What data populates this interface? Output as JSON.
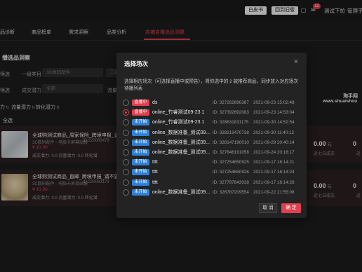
{
  "topbar": {
    "whitepaper": "白皮书",
    "back_old": "回到旧版",
    "notif_count": "12",
    "test_shop": "测试下拉",
    "admin": "管理子号"
  },
  "nav": {
    "items": [
      "品诊断",
      "商品榜单",
      "需求洞察",
      "品类分析",
      "店铺自播选品测算"
    ]
  },
  "section": {
    "title": "播选品洞察",
    "filter1_label": "筛选",
    "category_label": "一级类目",
    "category_value": "3C数码配件",
    "level2_placeholder": "二级",
    "filter2_label": "筛选",
    "deal_potential_label": "成交潜力",
    "deal_potential_value": "全部",
    "traffic_label": "流量",
    "sort": [
      "力",
      "流量潜力",
      "转化潜力"
    ],
    "selected_label": "全选"
  },
  "cards": [
    {
      "title": "全球购测试商品_周家保险_跨境申报_请不要",
      "category": "3C数码配件 - 电脑卡屏幕贴膜",
      "id": "ID:220083479",
      "price": "¥ 10.00",
      "stats": "成交潜力: 0.0   流量潜力: 0.0   转化潜",
      "value": "0.00",
      "unit": "元",
      "note": "近七日成交",
      "note2": "近"
    },
    {
      "title": "全球购测试商品_直邮_跨境申报_请不要拍",
      "category": "3C数码配件 - 电脑卡屏幕贴膜",
      "id": "ID:220083179",
      "price": "¥ 10.00",
      "stats": "成交潜力: 0.0   流量潜力: 0.0   转化潜",
      "value": "0.00",
      "unit": "元",
      "note": "近七日成交",
      "note2": "近"
    }
  ],
  "watermark": {
    "line1": "淘手网",
    "line2": "www.shuaishou"
  },
  "modal": {
    "title": "选择场次",
    "close": "×",
    "description": "选择相应场次（可选择直播中或预告），将你选中的 2 款推荐商品，同步放入对应场次待播列表",
    "tags": {
      "live": "直播中",
      "soon": "未开始"
    },
    "sessions": [
      {
        "status": "live",
        "name": "ds",
        "id": "ID:  327262696387",
        "time": "2021-09-23  15:02:48",
        "checked": false
      },
      {
        "status": "live",
        "name": "online_竹睿测试09-23 1",
        "id": "ID:  327392692083",
        "time": "2021-09-23  14:53:04",
        "checked": true
      },
      {
        "status": "soon",
        "name": "online_竹睿测试09-23 1",
        "id": "ID:  328631831175",
        "time": "2021-09-30  14:52:54",
        "checked": false
      },
      {
        "status": "soon",
        "name": "online_数据准备_测试09...",
        "id": "ID:  328213470738",
        "time": "2021-09-30  11:40:12",
        "checked": false
      },
      {
        "status": "soon",
        "name": "online_数据准备_测试09...",
        "id": "ID:  328147190010",
        "time": "2021-09-29  20:40:14",
        "checked": false
      },
      {
        "status": "soon",
        "name": "online_数据准备_测试09...",
        "id": "ID:  327846191058",
        "time": "2021-09-24  20:18:17",
        "checked": false
      },
      {
        "status": "soon",
        "name": "tttt",
        "id": "ID:  327254650925",
        "time": "2021-09-17  16:14:21",
        "checked": false
      },
      {
        "status": "soon",
        "name": "tttt",
        "id": "ID:  327254650926",
        "time": "2021-09-17  16:14:24",
        "checked": false
      },
      {
        "status": "soon",
        "name": "tttt",
        "id": "ID:  327787843028",
        "time": "2021-09-17  16:14:26",
        "checked": false
      },
      {
        "status": "soon",
        "name": "online_数据准备_测试09...",
        "id": "ID:  326787209554",
        "time": "2021-09-22  21:55:08",
        "checked": false
      }
    ],
    "cancel": "取 消",
    "confirm": "确 定"
  },
  "colors": {
    "accent": "#e0404e",
    "blue_tag": "#2f7fd6"
  }
}
